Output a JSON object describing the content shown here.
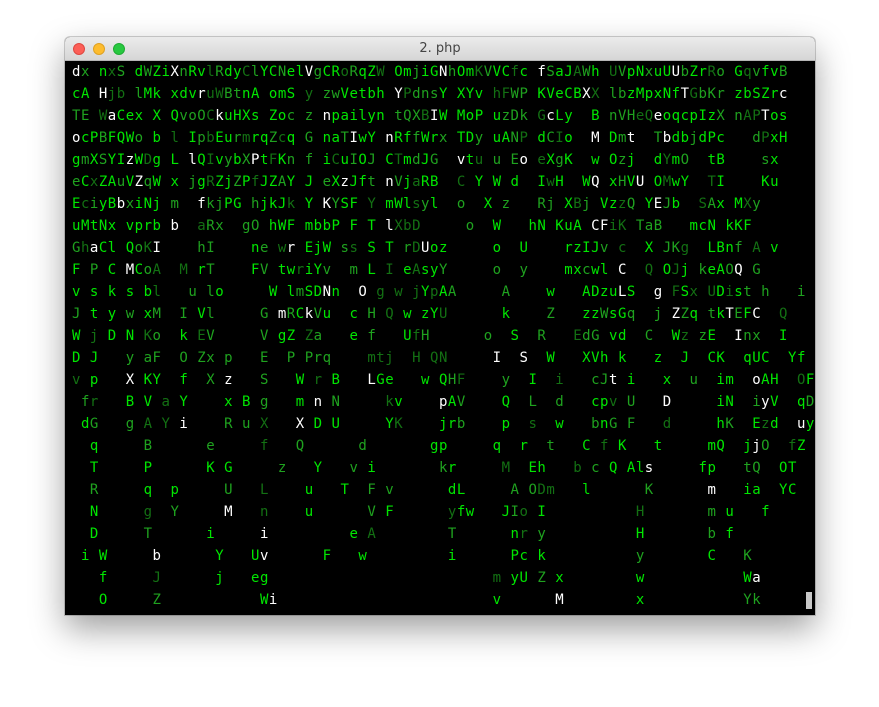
{
  "window": {
    "title": "2. php",
    "controls": {
      "close": "close-icon",
      "minimize": "minimize-icon",
      "maximize": "maximize-icon"
    }
  },
  "colors": {
    "bright": "#00e600",
    "mid": "#1fa21f",
    "dim": "#137013",
    "white": "#ffffff",
    "background": "#000000"
  },
  "terminal": {
    "lines": [
      "dx nxS dWZiXnRvlRdyClYCNelVgCRoRqZW OmjiGNhOmKVVCfc fSaJAWh UVpNxuUUbZrRo GqvfvB",
      "cA Hjb lMk xdvruWBtnA omS y zwVetbh YPdnsY XYv hFWP KVeCBXX lbzMpxNfTGbKr zbSZrc",
      "TE WaCex X QvoOCkuHXs Zoc z npailyn tQXBIW MoP uzDk GcLy  B nVHeQeoqcpIzX nAPTos",
      "ocPBFQWo b l IpbEurmrqZcq G naTIwY nRffWrx TDy uANP dCIo  M Dmt  TbdbjdPc   dPxH",
      "gmXSYIzWDg L lQIvybXPtFKn f iCuIOJ CTmdJG  vtu u Eo eXgK  w Ozj  dYmO  tB    sx",
      "eCxZAuVZqW x jgRZjZPfJZAY J eXzJft nVjaRB  C Y W d  IwH  WQ xHVU OMwY  TI    Ku",
      "EciyBbxiNj m  fkjPG hjkJk Y KYSF Y mWlsyl  o  X z   Rj XBj VzzQ YEJb  SAx MXy",
      "uMtNx vprb b  aRx  gO hWF mbbP F T lXbD     o  W   hN KuA CFiK TaB   mcN kKF",
      "GhaCl QoKI    hI    ne wr EjW ss S T rDUoz     o  U    rzIJv c  X JKg  LBnf A v",
      "F P C MCoA  M rT    FV twriYv  m L I eAsyY     o  y    mxcwl C  Q OJj keAOQ G",
      "v s k s bl   u lo     W lmSDNn  O g w jYpAA     A    w   ADzuLS  g FSx UDist h   i",
      "J t y w xM  I Vl     G mRCkVu  c H Q w zYU      k    Z   zzWsGq  j ZZq tkTEFC  Q",
      "W j D N Ko  k EV     V gZ Za   e f   UfH      o  S  R   EdG vd  C  Wz zE  Inx  I",
      "D J   y aF  O Zx p   E  P Prq    mtj  H QN     I  S  W   XVh k   z  J  CK  qUC  Yf",
      "v p   X KY  f  X z   S   W r B   LGe   w QHF    y  I  i   cJt i   x  u  im  oAH  OF",
      " fr   B V a Y    x B g   m n N     kv    pAV    Q  L  d   cpv U   D     iN  iyV  qD",
      " dG   g A Y i    R u X   X D U     YK    jrb    p  s  w   bnG F   d     hK  Ezd  uy",
      "  q     B      e     f   Q      d       gp     q  r  t   C f K   t     mQ  jjO  fZ",
      "  T     P      K G     z   Y   v i       kr     M  Eh   b c Q Als     fp   tQ  OT",
      "  R     q  p     U   L    u   T  F v      dL     A ODm   l      K      m   ia  YC",
      "  N     g  Y     M   n    u      V F      yfw   JIo I          H       m u   f",
      "  D     T      i     i         e A        T      nr y          H       b f",
      " i W     b      Y   Uv      F   w         i      Pc k          y       C   K",
      "   f     J      j   eg                         m yU Z x        w           Wa",
      "   O     Z           Wi                        v      M        x           Yk"
    ]
  }
}
